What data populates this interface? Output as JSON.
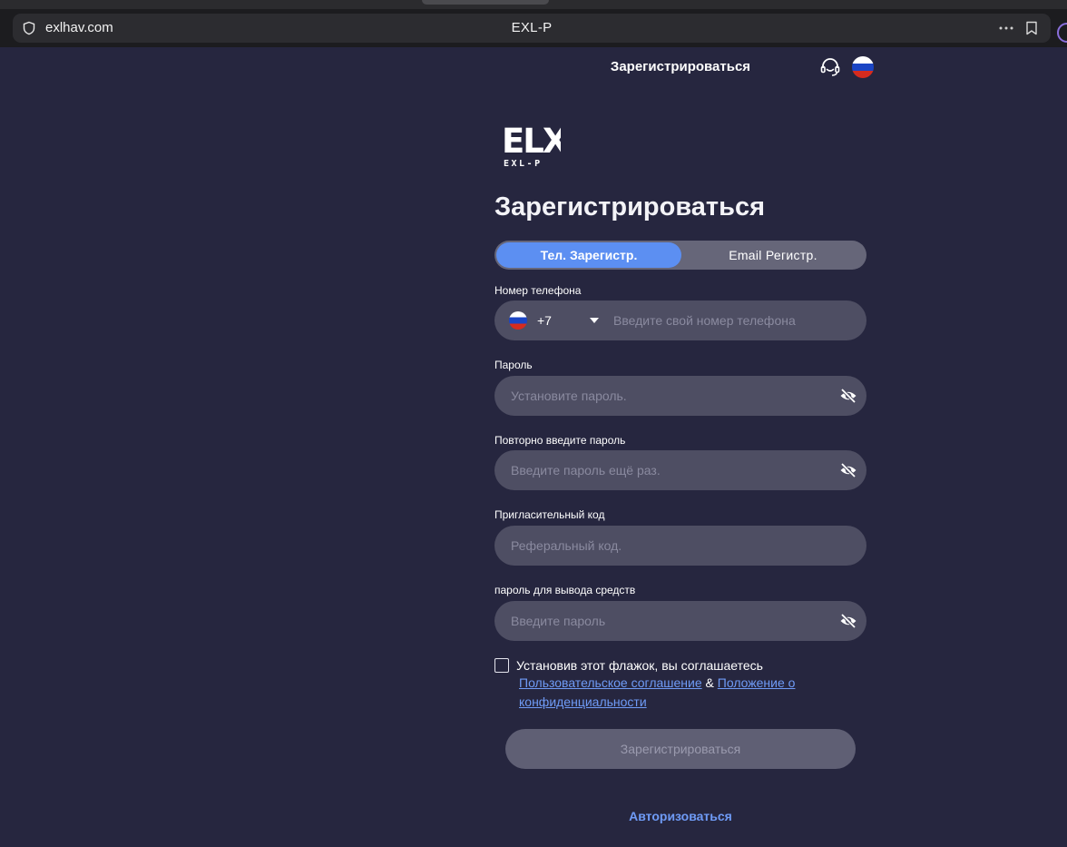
{
  "browser": {
    "url": "exlhav.com",
    "title": "EXL-P",
    "icons": [
      "shield-icon",
      "more-icon",
      "bookmark-icon"
    ]
  },
  "header": {
    "title": "Зарегистрироваться",
    "support_icon": "headset-icon",
    "language_flag": "russia-flag-icon"
  },
  "logo": {
    "mark": "ELX",
    "subtitle": "EXL-P"
  },
  "form": {
    "title": "Зарегистрироваться",
    "tabs": [
      {
        "label": "Тел. Зарегистр.",
        "active": true
      },
      {
        "label": "Email Регистр.",
        "active": false
      }
    ],
    "phone": {
      "label": "Номер телефона",
      "country_code": "+7",
      "placeholder": "Введите свой номер телефона"
    },
    "password": {
      "label": "Пароль",
      "placeholder": "Установите пароль."
    },
    "confirm_password": {
      "label": "Повторно введите пароль",
      "placeholder": "Введите пароль ещё раз."
    },
    "invite_code": {
      "label": "Пригласительный код",
      "placeholder": "Реферальный код."
    },
    "withdraw_password": {
      "label": "пароль для вывода средств",
      "placeholder": "Введите пароль"
    },
    "agreement": {
      "checked": false,
      "text": "Установив этот флажок, вы соглашаетесь",
      "user_agreement": "Пользовательское соглашение",
      "separator": "&",
      "privacy_policy": "Положение о конфиденциальности"
    },
    "submit_label": "Зарегистрироваться",
    "login_label": "Авторизоваться"
  },
  "colors": {
    "background": "#26263f",
    "accent": "#5c8ff2",
    "link": "#6f9bf6",
    "field": "#4e4e63"
  }
}
